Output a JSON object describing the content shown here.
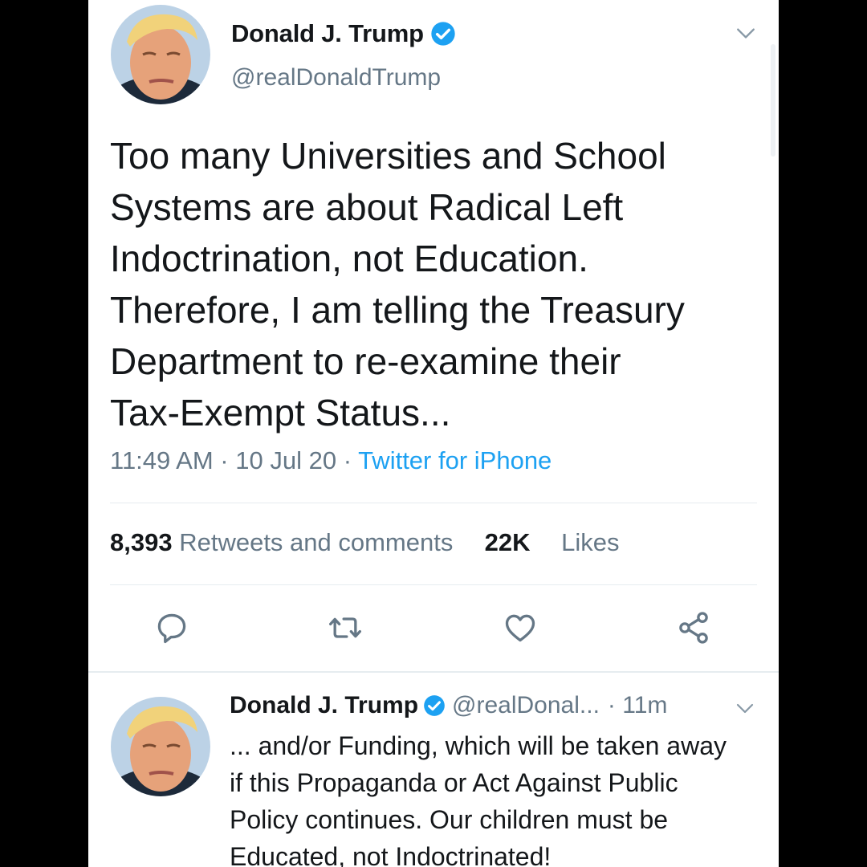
{
  "tweet": {
    "author_name": "Donald J. Trump",
    "author_handle": "@realDonaldTrump",
    "verified_icon": "verified-badge-icon",
    "text_lines": [
      "Too many Universities and School",
      "Systems are about Radical Left",
      "Indoctrination, not Education.",
      "Therefore, I am telling the Treasury",
      "Department to re-examine their",
      "Tax-Exempt Status..."
    ],
    "time": "11:49 AM",
    "date": "10 Jul 20",
    "separator": " · ",
    "source": "Twitter for iPhone",
    "retweets_count": "8,393",
    "retweets_label": "Retweets and comments",
    "likes_count": "22K",
    "likes_label": "Likes"
  },
  "actions": {
    "reply_icon": "reply-icon",
    "retweet_icon": "retweet-icon",
    "like_icon": "heart-icon",
    "share_icon": "share-icon"
  },
  "reply": {
    "author_name": "Donald J. Trump",
    "author_handle": "@realDonal...",
    "age": "· 11m",
    "text_lines": [
      "... and/or Funding, which will be taken away",
      "if this Propaganda or Act Against Public",
      "Policy continues. Our children must be",
      "Educated, not Indoctrinated!"
    ]
  },
  "colors": {
    "accent": "#1da1f2",
    "secondary_text": "#657786",
    "primary_text": "#14171a",
    "divider": "#e6ecf0",
    "frame": "#000000"
  }
}
